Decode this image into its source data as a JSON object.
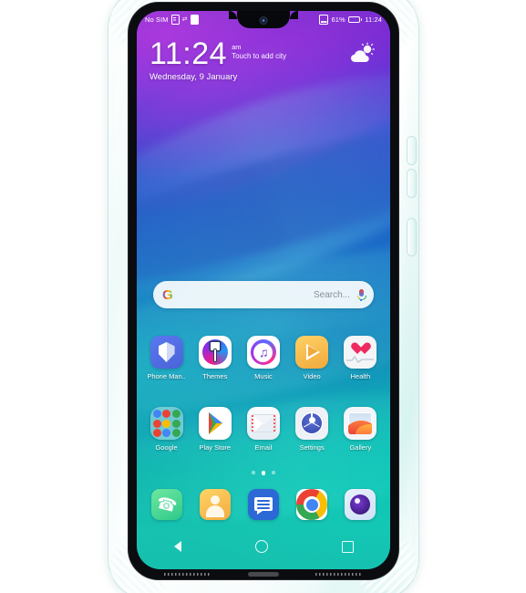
{
  "device": {
    "type": "smartphone-in-clear-case",
    "case_description": "transparent shockproof TPU case with reinforced corner bumpers"
  },
  "status_bar": {
    "carrier": "No SIM",
    "sim_icon": "sim-card-icon",
    "transfer_icon": "data-transfer-icon",
    "signal_icon": "signal-bars-icon",
    "battery_percent": "61%",
    "battery_icon": "battery-icon",
    "time": "11:24"
  },
  "clock_widget": {
    "time": "11:24",
    "ampm": "am",
    "city_hint": "Touch to add city",
    "date": "Wednesday, 9 January",
    "weather_icon": "sun-behind-cloud-icon"
  },
  "search": {
    "logo": "google-g-icon",
    "placeholder": "Search...",
    "mic_icon": "microphone-icon"
  },
  "home_screen": {
    "rows": [
      {
        "apps": [
          {
            "label": "Phone Man..",
            "icon": "shield-icon"
          },
          {
            "label": "Themes",
            "icon": "paint-brush-icon"
          },
          {
            "label": "Music",
            "icon": "music-note-icon"
          },
          {
            "label": "Video",
            "icon": "play-triangle-icon"
          },
          {
            "label": "Health",
            "icon": "heart-pulse-icon"
          }
        ]
      },
      {
        "apps": [
          {
            "label": "Google",
            "icon": "folder-icon"
          },
          {
            "label": "Play Store",
            "icon": "play-store-icon"
          },
          {
            "label": "Email",
            "icon": "envelope-icon"
          },
          {
            "label": "Settings",
            "icon": "settings-gear-icon"
          },
          {
            "label": "Gallery",
            "icon": "photo-icon"
          }
        ]
      }
    ],
    "page_indicator": {
      "total": 3,
      "active_index": 1
    },
    "dock": [
      {
        "label": "Phone",
        "icon": "phone-handset-icon"
      },
      {
        "label": "Contacts",
        "icon": "person-icon"
      },
      {
        "label": "Messages",
        "icon": "message-bubble-icon"
      },
      {
        "label": "Chrome",
        "icon": "chrome-icon"
      },
      {
        "label": "Camera",
        "icon": "camera-lens-icon"
      }
    ],
    "google_folder_colors": [
      "#4285F4",
      "#EA4335",
      "#34A853",
      "#EA4335",
      "#FBBC05",
      "#34A853",
      "#EA4335",
      "#4285F4",
      "#34A853"
    ]
  },
  "nav_bar": {
    "back": "back-triangle-icon",
    "home": "home-circle-icon",
    "recents": "recents-square-icon"
  },
  "colors": {
    "wallpaper_top": "#6a2ec9",
    "wallpaper_mid": "#1a73c6",
    "wallpaper_bottom": "#16bfae",
    "status_text": "#ffffff",
    "search_bg": "#ffffff",
    "search_placeholder": "#8b8f94"
  }
}
